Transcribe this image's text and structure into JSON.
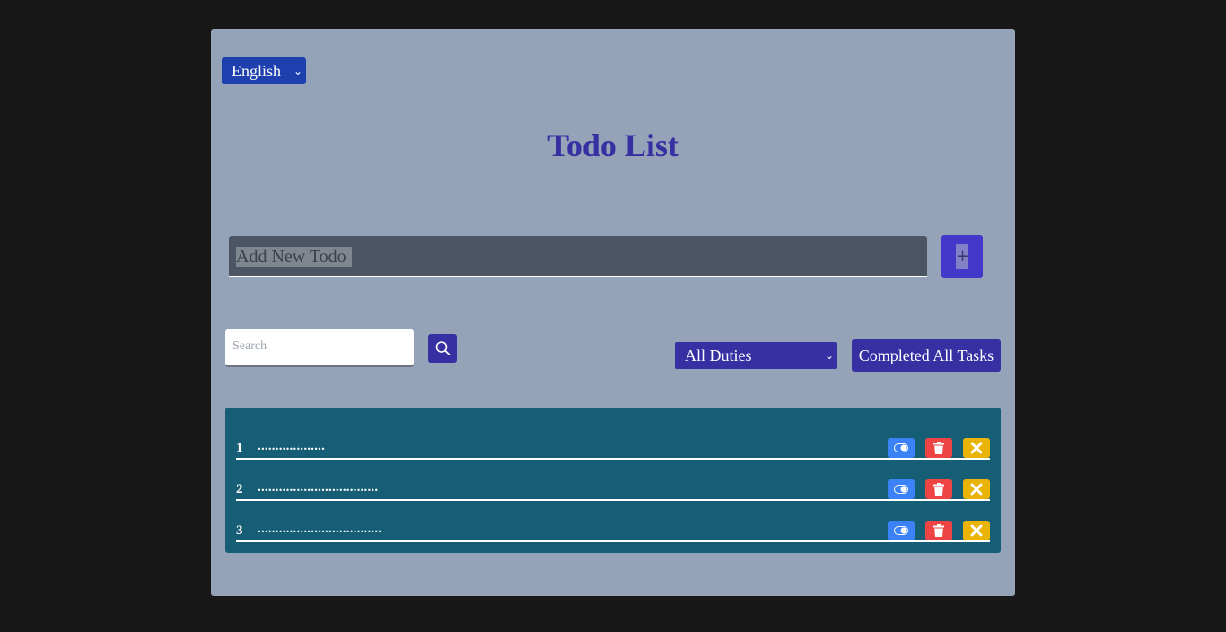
{
  "language": {
    "selected": "English"
  },
  "title": "Todo List",
  "new_todo": {
    "placeholder": "Add New Todo",
    "add_label": "+"
  },
  "search": {
    "placeholder": "Search"
  },
  "filter": {
    "selected": "All Duties"
  },
  "complete_all_label": "Completed All Tasks",
  "todos": [
    {
      "num": "1",
      "text": "..................."
    },
    {
      "num": "2",
      "text": ".................................."
    },
    {
      "num": "3",
      "text": "..................................."
    }
  ],
  "colors": {
    "background": "#181818",
    "card": "#95a3b8",
    "accent": "#3730a3",
    "list": "#155e75",
    "toggle": "#3b82f6",
    "delete": "#ef4444",
    "remove": "#eab308"
  },
  "icons": {
    "search": "magnifier-icon",
    "toggle": "toggle-icon",
    "delete": "trash-icon",
    "remove": "close-icon"
  }
}
